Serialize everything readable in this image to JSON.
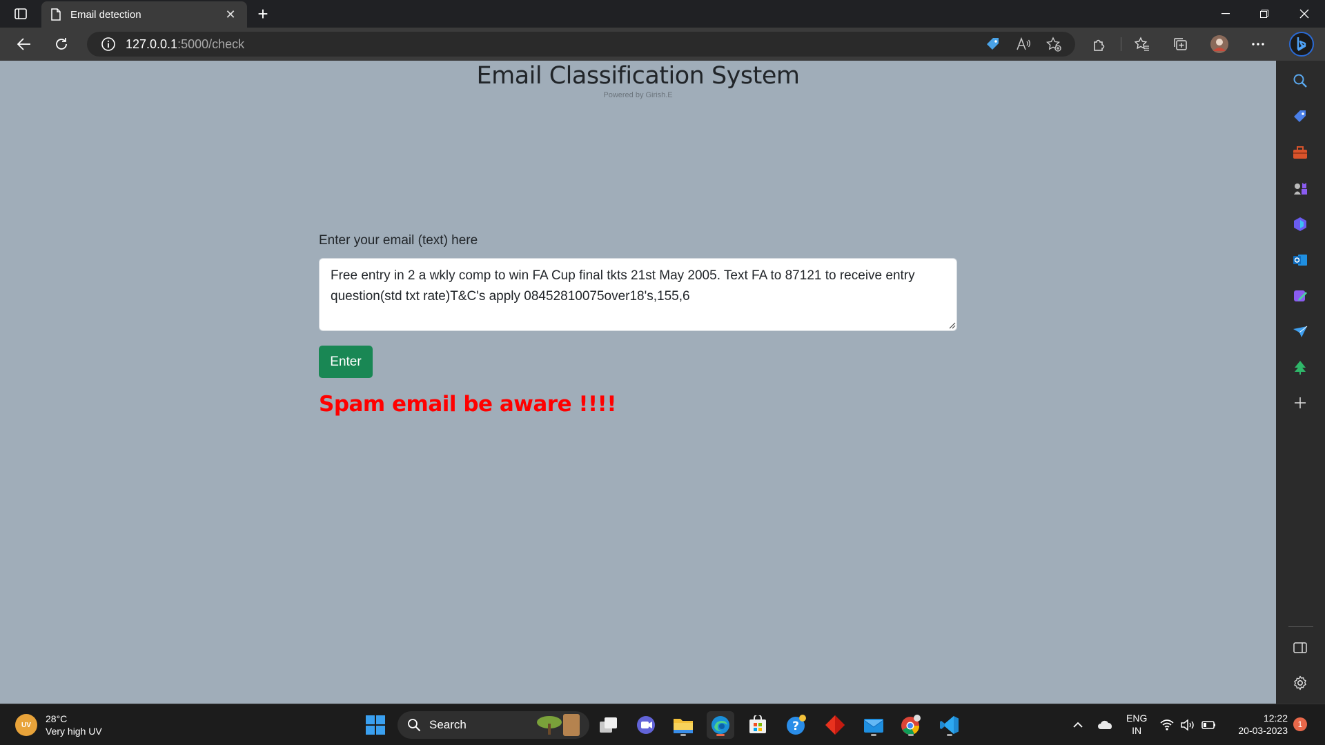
{
  "browser": {
    "tab_title": "Email detection",
    "tab_close": "✕",
    "new_tab": "+",
    "url_host": "127.0.0.1",
    "url_path": ":5000/check"
  },
  "page": {
    "title": "Email Classification System",
    "subtitle": "Powered by Girish.E",
    "form_label": "Enter your email (text) here",
    "textarea_value": "Free entry in 2 a wkly comp to win FA Cup final tkts 21st May 2005. Text FA to 87121 to receive entry question(std txt rate)T&C's apply 08452810075over18's,155,6",
    "enter_label": "Enter",
    "result": "Spam email be aware !!!!"
  },
  "colors": {
    "page_bg": "#a0adb9",
    "enter_button": "#198754",
    "result_text": "#ff0000"
  },
  "taskbar": {
    "weather_badge": "UV",
    "weather_temp": "28°C",
    "weather_desc": "Very high UV",
    "search_label": "Search",
    "lang_top": "ENG",
    "lang_bottom": "IN",
    "time": "12:22",
    "date": "20-03-2023",
    "notification_count": "1"
  }
}
